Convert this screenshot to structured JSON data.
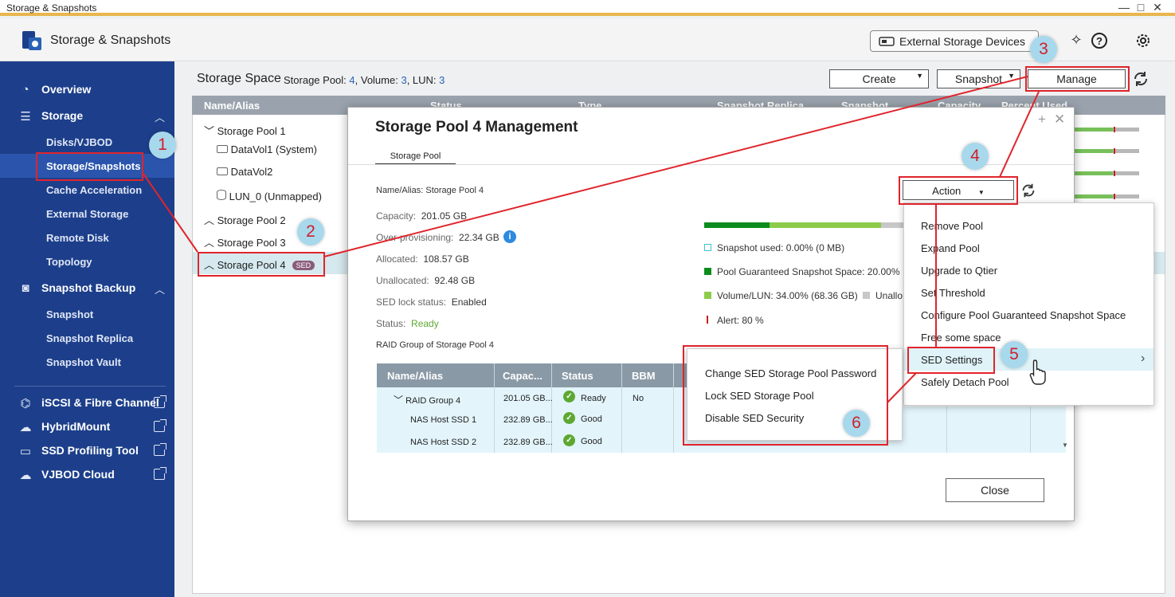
{
  "window": {
    "title": "Storage & Snapshots",
    "controls": [
      "—",
      "□",
      "✕"
    ]
  },
  "header": {
    "app_title": "Storage & Snapshots",
    "external_devices_label": "External Storage Devices"
  },
  "sidebar": {
    "overview": "Overview",
    "storage": "Storage",
    "storage_items": [
      "Disks/VJBOD",
      "Storage/Snapshots",
      "Cache Acceleration",
      "External Storage",
      "Remote Disk",
      "Topology"
    ],
    "snapshot_backup": "Snapshot Backup",
    "snapshot_items": [
      "Snapshot",
      "Snapshot Replica",
      "Snapshot Vault"
    ],
    "links": [
      "iSCSI & Fibre Channel",
      "HybridMount",
      "SSD Profiling Tool",
      "VJBOD Cloud"
    ]
  },
  "main": {
    "title": "Storage Space",
    "summary_pool_label": "Storage Pool:",
    "pool_count": "4",
    "summary_volume_label": ", Volume:",
    "volume_count": "3",
    "summary_lun_label": ", LUN:",
    "lun_count": "3",
    "create_label": "Create",
    "snapshot_label": "Snapshot",
    "manage_label": "Manage",
    "columns": [
      "Name/Alias",
      "Status",
      "Type",
      "Snapshot Replica",
      "Snapshot",
      "Capacity",
      "Percent Used"
    ],
    "rows": [
      {
        "name": "Storage Pool 1",
        "used": 0.6
      },
      {
        "name": "DataVol1 (System)",
        "used": 0.6
      },
      {
        "name": "DataVol2",
        "used": 0.6
      },
      {
        "name": "LUN_0 (Unmapped)",
        "used": 0.6
      },
      {
        "name": "Storage Pool 2"
      },
      {
        "name": "Storage Pool 3"
      },
      {
        "name": "Storage Pool 4",
        "badge": "SED"
      }
    ]
  },
  "modal": {
    "title": "Storage Pool 4 Management",
    "tab": "Storage Pool",
    "name_alias": "Name/Alias: Storage Pool 4",
    "action_label": "Action",
    "capacity_label": "Capacity:",
    "capacity": "201.05 GB",
    "overprov_label": "Over-provisioning:",
    "overprov": "22.34 GB",
    "allocated_label": "Allocated:",
    "allocated": "108.57 GB",
    "unallocated_label": "Unallocated:",
    "unallocated": "92.48 GB",
    "sed_lock_label": "SED lock status:",
    "sed_lock": "Enabled",
    "status_label": "Status:",
    "status": "Ready",
    "raid_group_title": "RAID Group of Storage Pool 4",
    "legend": {
      "snapshot_used": "Snapshot used: 0.00% (0 MB)",
      "guaranteed": "Pool Guaranteed Snapshot Space: 20.00% (",
      "volume_lun": "Volume/LUN: 34.00% (68.36 GB)",
      "unallocated": "Unallo",
      "alert": "Alert: 80 %"
    },
    "raid_columns": [
      "Name/Alias",
      "Capac...",
      "Status",
      "BBM"
    ],
    "raid_rows": [
      {
        "name": "RAID Group 4",
        "capacity": "201.05 GB...",
        "status": "Ready",
        "bbm": "No"
      },
      {
        "name": "NAS Host SSD 1",
        "capacity": "232.89 GB...",
        "status": "Good",
        "bbm": ""
      },
      {
        "name": "NAS Host SSD 2",
        "capacity": "232.89 GB...",
        "status": "Good",
        "bbm": ""
      }
    ],
    "close_label": "Close"
  },
  "action_menu": [
    "Remove Pool",
    "Expand Pool",
    "Upgrade to Qtier",
    "Set Threshold",
    "Configure Pool Guaranteed Snapshot Space",
    "Free some space",
    "SED Settings",
    "Safely Detach Pool"
  ],
  "sed_menu": [
    "Change SED Storage Pool Password",
    "Lock SED Storage Pool",
    "Disable SED Security"
  ],
  "steps": [
    "1",
    "2",
    "3",
    "4",
    "5",
    "6"
  ],
  "colors": {
    "sidebar": "#1d3f8b",
    "annotation": "#e0242c",
    "ready": "#5ea832",
    "accent": "#2a62b5"
  }
}
